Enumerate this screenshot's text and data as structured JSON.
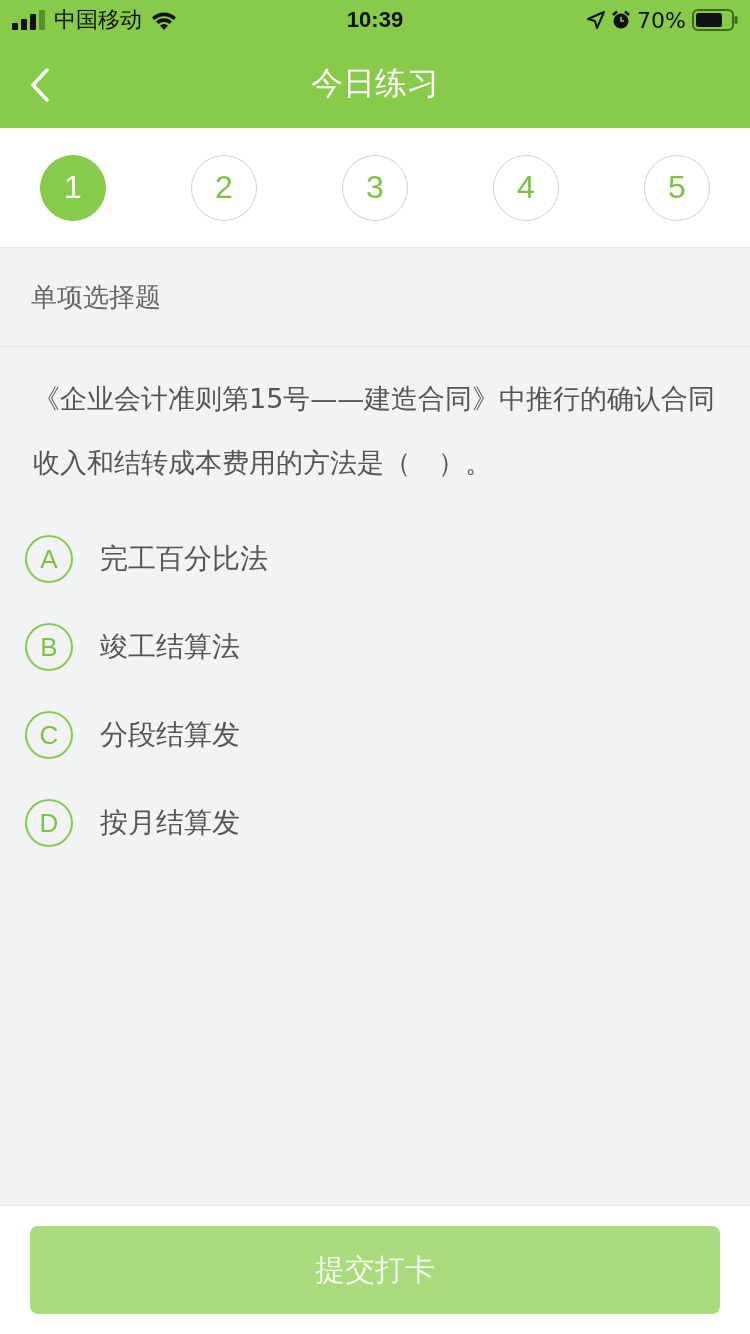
{
  "status_bar": {
    "carrier": "中国移动",
    "time": "10:39",
    "battery": "70%"
  },
  "nav": {
    "title": "今日练习"
  },
  "steps": [
    {
      "label": "1",
      "selected": true
    },
    {
      "label": "2",
      "selected": false
    },
    {
      "label": "3",
      "selected": false
    },
    {
      "label": "4",
      "selected": false
    },
    {
      "label": "5",
      "selected": false
    }
  ],
  "section_title": "单项选择题",
  "question": "《企业会计准则第15号——建造合同》中推行的确认合同收入和结转成本费用的方法是（　）。",
  "options": [
    {
      "letter": "A",
      "text": "完工百分比法",
      "selected": false
    },
    {
      "letter": "B",
      "text": "竣工结算法",
      "selected": false
    },
    {
      "letter": "C",
      "text": "分段结算发",
      "selected": false
    },
    {
      "letter": "D",
      "text": "按月结算发",
      "selected": false
    }
  ],
  "submit": {
    "label": "提交打卡",
    "disabled": true
  }
}
